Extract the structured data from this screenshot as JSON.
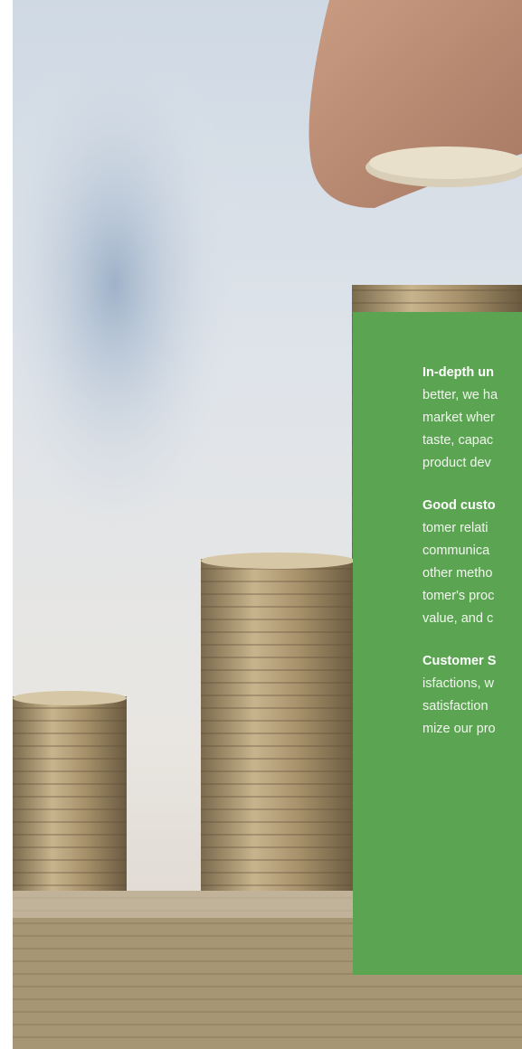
{
  "hero_image": {
    "icon": "coin-stack-photo"
  },
  "sections": [
    {
      "heading": "In-depth un",
      "lines": [
        "better, we ha",
        "market wher",
        "taste, capac",
        "product dev"
      ]
    },
    {
      "heading": "Good custo",
      "lines": [
        "tomer relati",
        "communica",
        "other metho",
        "tomer's proc",
        "value, and c"
      ]
    },
    {
      "heading": "Customer S",
      "lines": [
        "isfactions, w",
        "satisfaction",
        "mize our pro"
      ]
    }
  ],
  "colors": {
    "panel": "#5ba552",
    "text": "#ffffff"
  }
}
